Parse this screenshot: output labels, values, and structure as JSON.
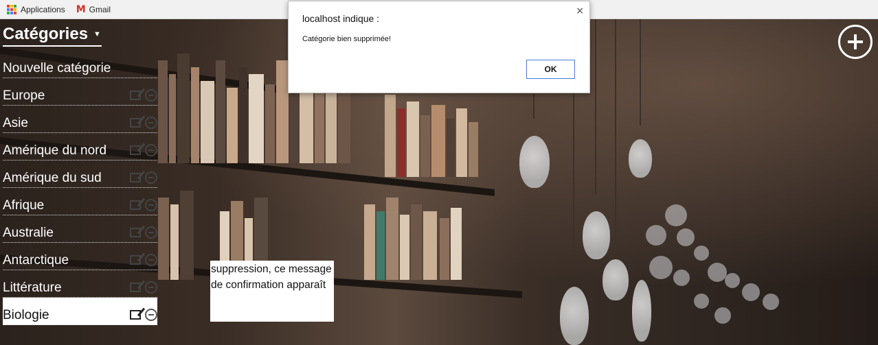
{
  "bookmarks": {
    "applications": "Applications",
    "gmail": "Gmail"
  },
  "menu": {
    "title": "Catégories",
    "new_category": "Nouvelle catégorie",
    "items": [
      {
        "label": "Europe"
      },
      {
        "label": "Asie"
      },
      {
        "label": "Amérique du nord"
      },
      {
        "label": "Amérique du sud"
      },
      {
        "label": "Afrique"
      },
      {
        "label": "Australie"
      },
      {
        "label": "Antarctique"
      },
      {
        "label": "Littérature"
      },
      {
        "label": "Biologie"
      }
    ],
    "active_item": "Biologie"
  },
  "dialog": {
    "title": "localhost indique :",
    "message": "Catégorie bien supprimée!",
    "ok_label": "OK",
    "close_glyph": "×"
  },
  "note": {
    "text": "suppression, ce message de confirmation apparaît"
  },
  "icons": {
    "apps": "apps-grid-icon",
    "gmail": "gmail-icon",
    "caret": "caret-down-icon",
    "edit": "edit-icon",
    "delete": "minus-circle-icon",
    "add": "plus-circle-icon"
  }
}
